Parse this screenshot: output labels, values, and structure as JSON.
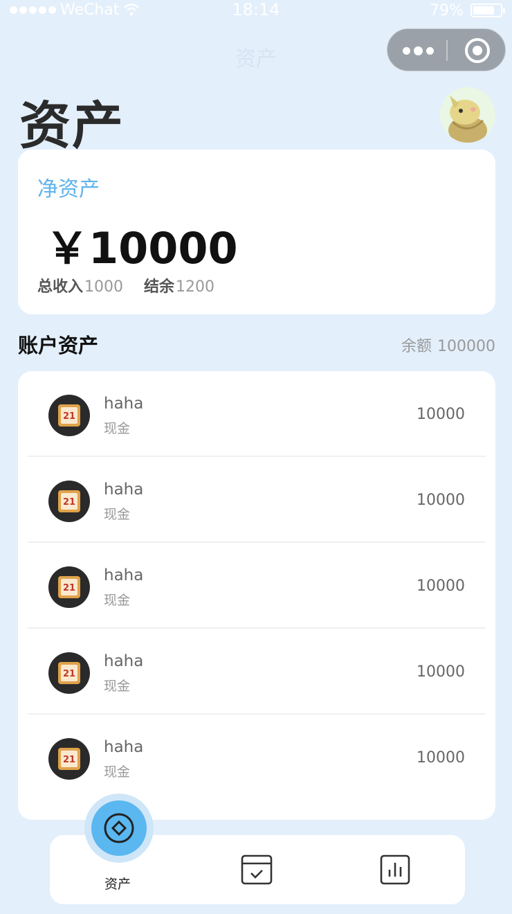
{
  "status_bar": {
    "carrier": "WeChat",
    "time": "18:14",
    "battery_percent": "79%",
    "battery_level": 0.79
  },
  "nav": {
    "title": "资产"
  },
  "page": {
    "title": "资产"
  },
  "net_assets": {
    "label": "净资产",
    "amount": "￥10000",
    "total_income_label": "总收入",
    "total_income_value": "1000",
    "surplus_label": "结余",
    "surplus_value": "1200"
  },
  "accounts_section": {
    "title": "账户资产",
    "balance_label": "余额",
    "balance_value": "100000"
  },
  "accounts": [
    {
      "name": "haha",
      "type": "现金",
      "amount": "10000",
      "icon": "calendar-21-icon"
    },
    {
      "name": "haha",
      "type": "现金",
      "amount": "10000",
      "icon": "calendar-21-icon"
    },
    {
      "name": "haha",
      "type": "现金",
      "amount": "10000",
      "icon": "calendar-21-icon"
    },
    {
      "name": "haha",
      "type": "现金",
      "amount": "10000",
      "icon": "calendar-21-icon"
    },
    {
      "name": "haha",
      "type": "现金",
      "amount": "10000",
      "icon": "calendar-21-icon"
    }
  ],
  "icon_badge_text": "21",
  "tabbar": {
    "tabs": [
      {
        "label": "资产",
        "icon": "asset-icon",
        "active": true
      },
      {
        "label": "",
        "icon": "calendar-check-icon",
        "active": false
      },
      {
        "label": "",
        "icon": "bar-chart-icon",
        "active": false
      }
    ]
  },
  "colors": {
    "background": "#e3effb",
    "accent": "#5ab7ef",
    "net_label": "#5eb3ec"
  }
}
